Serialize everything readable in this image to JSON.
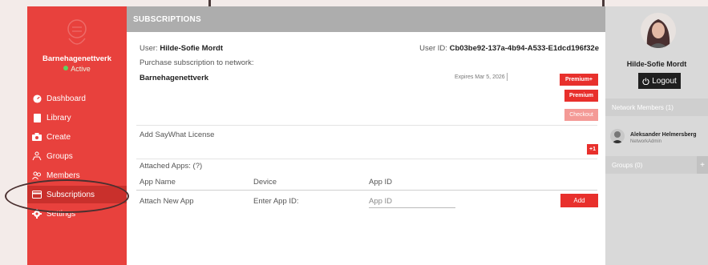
{
  "sidebar": {
    "org_name": "Barnehagenettverk",
    "status": "Active",
    "items": [
      {
        "label": "Dashboard",
        "icon": "dashboard-icon"
      },
      {
        "label": "Library",
        "icon": "library-icon"
      },
      {
        "label": "Create",
        "icon": "camera-icon"
      },
      {
        "label": "Groups",
        "icon": "groups-icon"
      },
      {
        "label": "Members",
        "icon": "members-icon"
      },
      {
        "label": "Subscriptions",
        "icon": "credit-card-icon"
      },
      {
        "label": "Settings",
        "icon": "gear-icon"
      }
    ],
    "active_item": "Subscriptions"
  },
  "header": {
    "title": "SUBSCRIPTIONS"
  },
  "main": {
    "user_label": "User:",
    "user_name": "Hilde-Sofie Mordt",
    "user_id_label": "User ID:",
    "user_id": "Cb03be92-137a-4b94-A533-E1dcd196f32e",
    "purchase_label": "Purchase subscription to network:",
    "network_name": "Barnehagenettverk",
    "expires": "Expires Mar 5, 2026",
    "premium_plus_button": "Premium+",
    "premium_button": "Premium",
    "checkout_button": "Checkout",
    "license_label": "Add SayWhat License",
    "license_button": "+1",
    "attached_apps_label": "Attached Apps: (?)",
    "columns": [
      "App Name",
      "Device",
      "App ID"
    ],
    "attach_row": {
      "label": "Attach New App",
      "device_label": "Enter App ID:",
      "app_id_placeholder": "App ID",
      "add_button": "Add"
    }
  },
  "right_panel": {
    "user_name": "Hilde-Sofie Mordt",
    "logout_label": "Logout",
    "members_header": "Network Members (1)",
    "members": [
      {
        "name": "Aleksander Helmersberg",
        "role": "NetworkAdmin"
      }
    ],
    "groups_header": "Groups (0)",
    "groups_add": "+"
  },
  "colors": {
    "sidebar_red": "#e8413d",
    "accent_red": "#e8302c",
    "header_gray": "#adadad",
    "active_green": "#5fd35f"
  }
}
